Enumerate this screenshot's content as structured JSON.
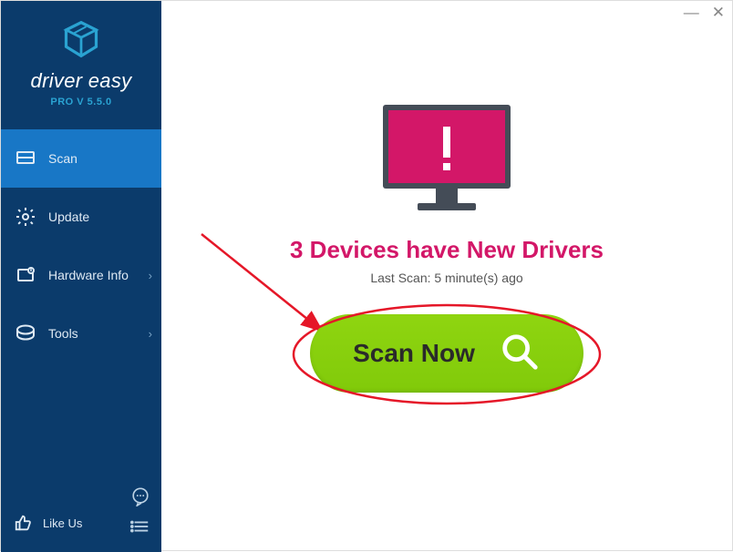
{
  "app": {
    "name": "driver easy",
    "version_label": "PRO V 5.5.0"
  },
  "sidebar": {
    "items": [
      {
        "label": "Scan",
        "icon": "scan-icon",
        "has_chevron": false,
        "active": true
      },
      {
        "label": "Update",
        "icon": "gear-icon",
        "has_chevron": false,
        "active": false
      },
      {
        "label": "Hardware Info",
        "icon": "hardware-info-icon",
        "has_chevron": true,
        "active": false
      },
      {
        "label": "Tools",
        "icon": "tools-icon",
        "has_chevron": true,
        "active": false
      }
    ],
    "footer": {
      "like_label": "Like Us"
    }
  },
  "main": {
    "headline": "3 Devices have New Drivers",
    "last_scan_label": "Last Scan: 5 minute(s) ago",
    "scan_button_label": "Scan Now"
  },
  "colors": {
    "accent_pink": "#d31768",
    "button_green": "#86cf0d",
    "sidebar_bg": "#0b3b6b",
    "sidebar_active": "#1877C6"
  }
}
